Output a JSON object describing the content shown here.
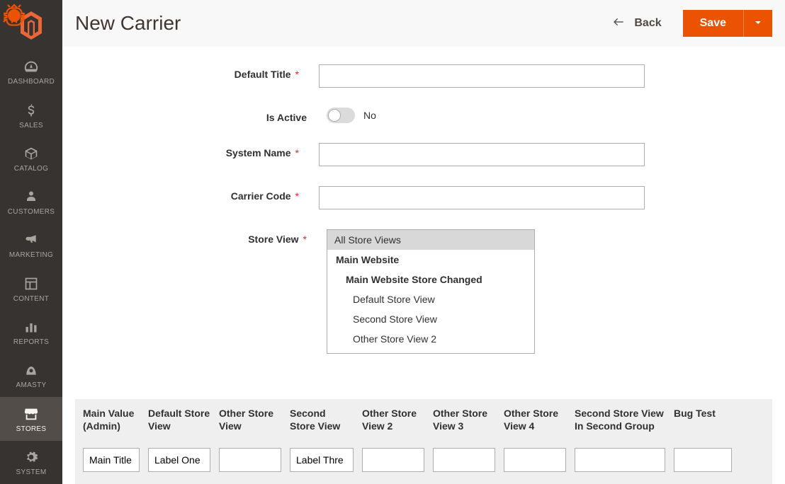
{
  "header": {
    "title": "New Carrier",
    "back_label": "Back",
    "save_label": "Save"
  },
  "sidebar": {
    "items": [
      {
        "label": "DASHBOARD",
        "icon": "dashboard"
      },
      {
        "label": "SALES",
        "icon": "dollar"
      },
      {
        "label": "CATALOG",
        "icon": "box"
      },
      {
        "label": "CUSTOMERS",
        "icon": "person"
      },
      {
        "label": "MARKETING",
        "icon": "megaphone"
      },
      {
        "label": "CONTENT",
        "icon": "layout"
      },
      {
        "label": "REPORTS",
        "icon": "bars"
      },
      {
        "label": "AMASTY",
        "icon": "amasty"
      },
      {
        "label": "STORES",
        "icon": "store"
      },
      {
        "label": "SYSTEM",
        "icon": "gear"
      }
    ],
    "active_index": 8
  },
  "form": {
    "default_title": {
      "label": "Default Title",
      "required": true,
      "value": ""
    },
    "is_active": {
      "label": "Is Active",
      "value": false,
      "display": "No"
    },
    "system_name": {
      "label": "System Name",
      "required": true,
      "value": ""
    },
    "carrier_code": {
      "label": "Carrier Code",
      "required": true,
      "value": ""
    },
    "store_view": {
      "label": "Store View",
      "required": true,
      "options": [
        {
          "label": "All Store Views",
          "level": null,
          "selected": true
        },
        {
          "label": "Main Website",
          "level": 0,
          "selected": false
        },
        {
          "label": "Main Website Store Changed",
          "level": 1,
          "selected": false
        },
        {
          "label": "Default Store View",
          "level": 2,
          "selected": false
        },
        {
          "label": "Second Store View",
          "level": 2,
          "selected": false
        },
        {
          "label": "Other Store View 2",
          "level": 2,
          "selected": false
        }
      ]
    }
  },
  "labels_grid": {
    "headers": [
      "Main Value (Admin)",
      "Default Store View",
      "Other Store View",
      "Second Store View",
      "Other Store View 2",
      "Other Store View 3",
      "Other Store View 4",
      "Second Store View In Second Group",
      "Bug Test"
    ],
    "values": [
      "Main Title",
      "Label One",
      "",
      "Label Thre",
      "",
      "",
      "",
      "",
      ""
    ]
  }
}
